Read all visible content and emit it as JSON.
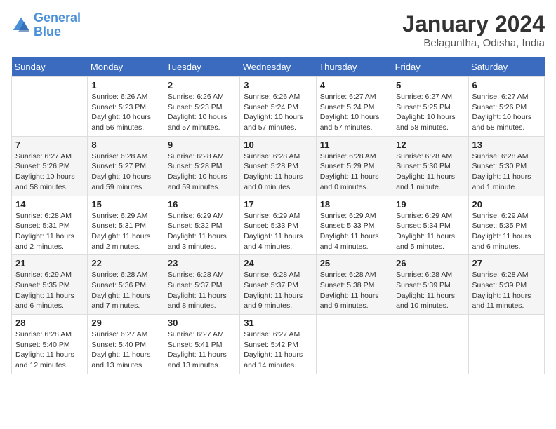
{
  "header": {
    "logo_line1": "General",
    "logo_line2": "Blue",
    "month": "January 2024",
    "location": "Belaguntha, Odisha, India"
  },
  "days_of_week": [
    "Sunday",
    "Monday",
    "Tuesday",
    "Wednesday",
    "Thursday",
    "Friday",
    "Saturday"
  ],
  "weeks": [
    [
      {
        "num": "",
        "info": ""
      },
      {
        "num": "1",
        "info": "Sunrise: 6:26 AM\nSunset: 5:23 PM\nDaylight: 10 hours\nand 56 minutes."
      },
      {
        "num": "2",
        "info": "Sunrise: 6:26 AM\nSunset: 5:23 PM\nDaylight: 10 hours\nand 57 minutes."
      },
      {
        "num": "3",
        "info": "Sunrise: 6:26 AM\nSunset: 5:24 PM\nDaylight: 10 hours\nand 57 minutes."
      },
      {
        "num": "4",
        "info": "Sunrise: 6:27 AM\nSunset: 5:24 PM\nDaylight: 10 hours\nand 57 minutes."
      },
      {
        "num": "5",
        "info": "Sunrise: 6:27 AM\nSunset: 5:25 PM\nDaylight: 10 hours\nand 58 minutes."
      },
      {
        "num": "6",
        "info": "Sunrise: 6:27 AM\nSunset: 5:26 PM\nDaylight: 10 hours\nand 58 minutes."
      }
    ],
    [
      {
        "num": "7",
        "info": "Sunrise: 6:27 AM\nSunset: 5:26 PM\nDaylight: 10 hours\nand 58 minutes."
      },
      {
        "num": "8",
        "info": "Sunrise: 6:28 AM\nSunset: 5:27 PM\nDaylight: 10 hours\nand 59 minutes."
      },
      {
        "num": "9",
        "info": "Sunrise: 6:28 AM\nSunset: 5:28 PM\nDaylight: 10 hours\nand 59 minutes."
      },
      {
        "num": "10",
        "info": "Sunrise: 6:28 AM\nSunset: 5:28 PM\nDaylight: 11 hours\nand 0 minutes."
      },
      {
        "num": "11",
        "info": "Sunrise: 6:28 AM\nSunset: 5:29 PM\nDaylight: 11 hours\nand 0 minutes."
      },
      {
        "num": "12",
        "info": "Sunrise: 6:28 AM\nSunset: 5:30 PM\nDaylight: 11 hours\nand 1 minute."
      },
      {
        "num": "13",
        "info": "Sunrise: 6:28 AM\nSunset: 5:30 PM\nDaylight: 11 hours\nand 1 minute."
      }
    ],
    [
      {
        "num": "14",
        "info": "Sunrise: 6:28 AM\nSunset: 5:31 PM\nDaylight: 11 hours\nand 2 minutes."
      },
      {
        "num": "15",
        "info": "Sunrise: 6:29 AM\nSunset: 5:31 PM\nDaylight: 11 hours\nand 2 minutes."
      },
      {
        "num": "16",
        "info": "Sunrise: 6:29 AM\nSunset: 5:32 PM\nDaylight: 11 hours\nand 3 minutes."
      },
      {
        "num": "17",
        "info": "Sunrise: 6:29 AM\nSunset: 5:33 PM\nDaylight: 11 hours\nand 4 minutes."
      },
      {
        "num": "18",
        "info": "Sunrise: 6:29 AM\nSunset: 5:33 PM\nDaylight: 11 hours\nand 4 minutes."
      },
      {
        "num": "19",
        "info": "Sunrise: 6:29 AM\nSunset: 5:34 PM\nDaylight: 11 hours\nand 5 minutes."
      },
      {
        "num": "20",
        "info": "Sunrise: 6:29 AM\nSunset: 5:35 PM\nDaylight: 11 hours\nand 6 minutes."
      }
    ],
    [
      {
        "num": "21",
        "info": "Sunrise: 6:29 AM\nSunset: 5:35 PM\nDaylight: 11 hours\nand 6 minutes."
      },
      {
        "num": "22",
        "info": "Sunrise: 6:28 AM\nSunset: 5:36 PM\nDaylight: 11 hours\nand 7 minutes."
      },
      {
        "num": "23",
        "info": "Sunrise: 6:28 AM\nSunset: 5:37 PM\nDaylight: 11 hours\nand 8 minutes."
      },
      {
        "num": "24",
        "info": "Sunrise: 6:28 AM\nSunset: 5:37 PM\nDaylight: 11 hours\nand 9 minutes."
      },
      {
        "num": "25",
        "info": "Sunrise: 6:28 AM\nSunset: 5:38 PM\nDaylight: 11 hours\nand 9 minutes."
      },
      {
        "num": "26",
        "info": "Sunrise: 6:28 AM\nSunset: 5:39 PM\nDaylight: 11 hours\nand 10 minutes."
      },
      {
        "num": "27",
        "info": "Sunrise: 6:28 AM\nSunset: 5:39 PM\nDaylight: 11 hours\nand 11 minutes."
      }
    ],
    [
      {
        "num": "28",
        "info": "Sunrise: 6:28 AM\nSunset: 5:40 PM\nDaylight: 11 hours\nand 12 minutes."
      },
      {
        "num": "29",
        "info": "Sunrise: 6:27 AM\nSunset: 5:40 PM\nDaylight: 11 hours\nand 13 minutes."
      },
      {
        "num": "30",
        "info": "Sunrise: 6:27 AM\nSunset: 5:41 PM\nDaylight: 11 hours\nand 13 minutes."
      },
      {
        "num": "31",
        "info": "Sunrise: 6:27 AM\nSunset: 5:42 PM\nDaylight: 11 hours\nand 14 minutes."
      },
      {
        "num": "",
        "info": ""
      },
      {
        "num": "",
        "info": ""
      },
      {
        "num": "",
        "info": ""
      }
    ]
  ]
}
